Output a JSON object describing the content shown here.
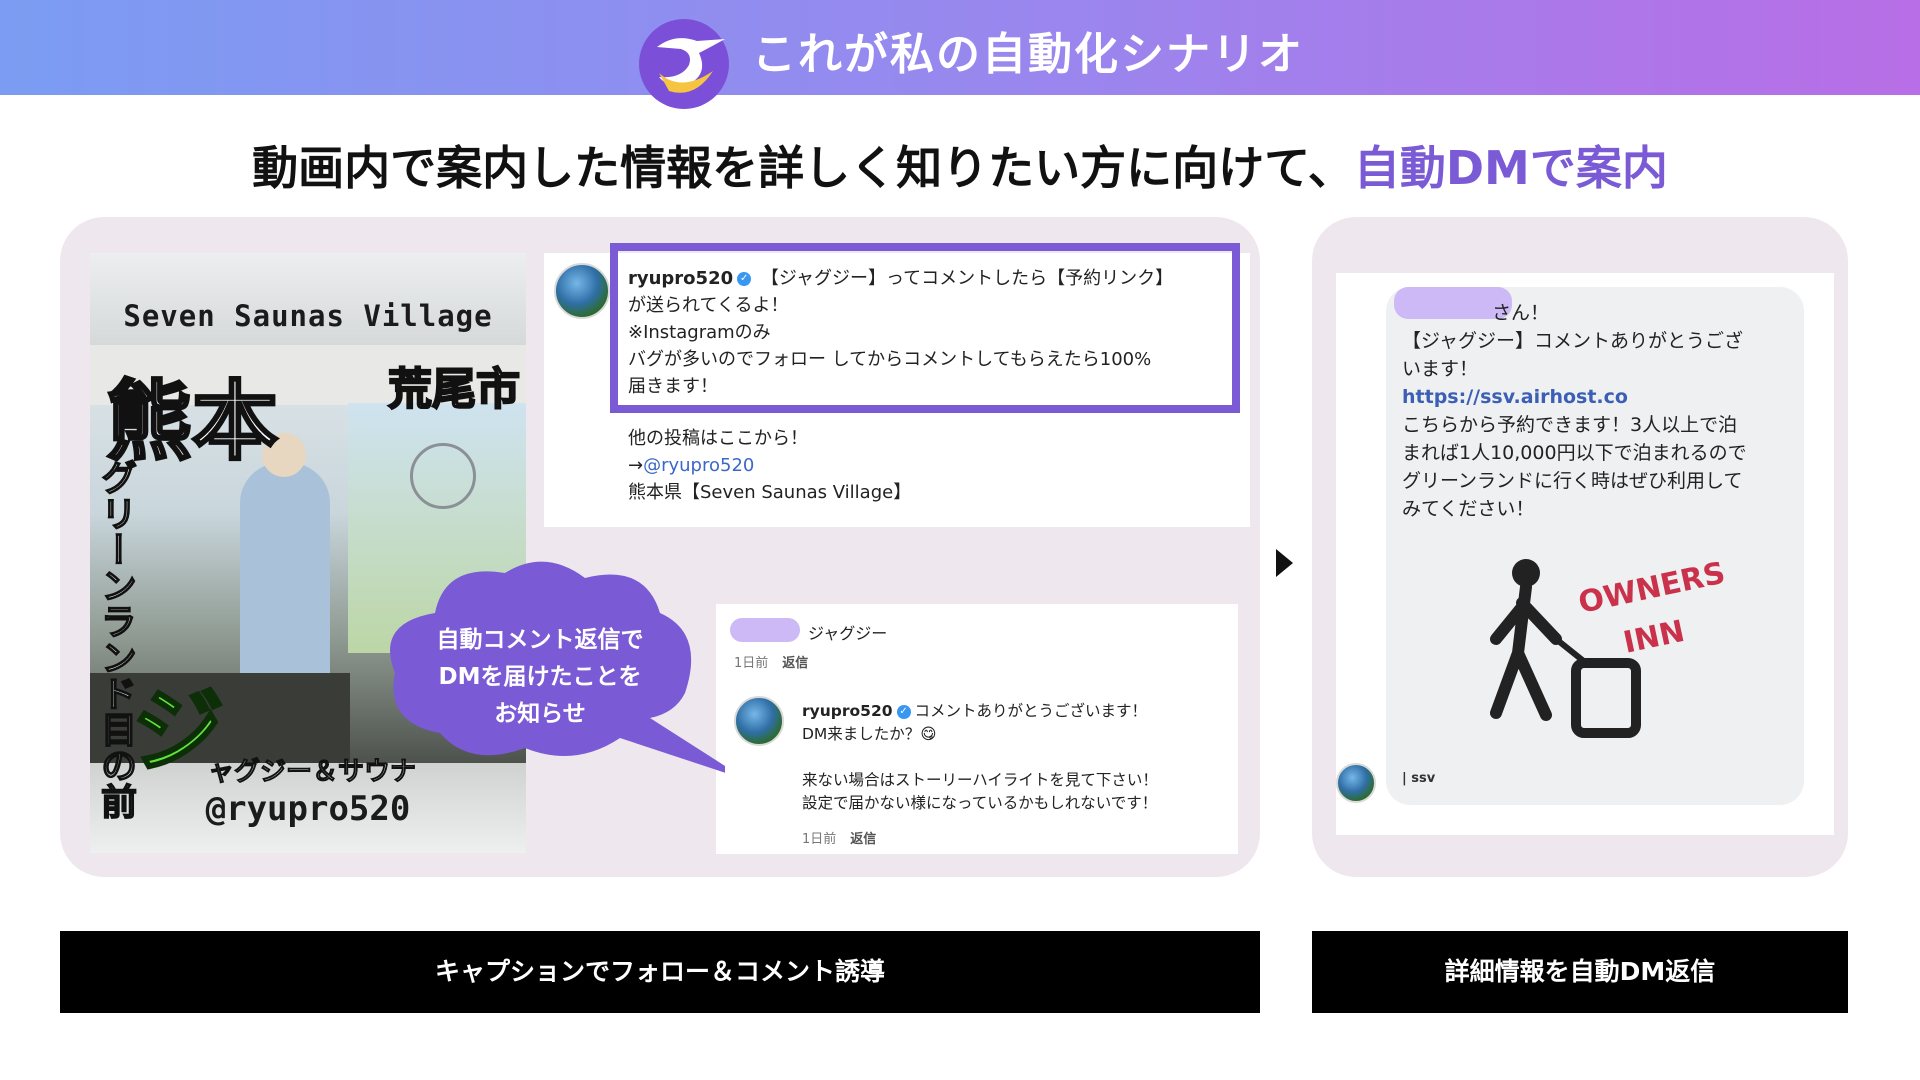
{
  "banner": {
    "title": "これが私の自動化シナリオ",
    "colors": {
      "start": "#7b9cf2",
      "end": "#b86ee6"
    }
  },
  "headline": {
    "text": "動画内で案内した情報を詳しく知りたい方に向けて、",
    "accent": "自動DMで案内",
    "accent_color": "#7b5ad6"
  },
  "thumbnail": {
    "venue": "Seven Saunas Village",
    "city_large": "熊本",
    "city_small": "荒尾市",
    "vertical": "グリーンランド目の前",
    "highlight": "ジ",
    "sub": "ャグジー＆サウナ",
    "handle": "@ryupro520"
  },
  "caption": {
    "username": "ryupro520",
    "line1": "【ジャグジー】ってコメントしたら【予約リンク】",
    "line2": "が送られてくるよ！",
    "line3": "※Instagramのみ",
    "line4": "バグが多いのでフォロー してからコメントしてもらえたら100%",
    "line5": "届きます！",
    "more1": "他の投稿はここから！",
    "more2_arrow": "→",
    "more2_link": "@ryupro520",
    "more3": "熊本県【Seven Saunas Village】",
    "highlight_color": "#7b5ad6"
  },
  "comment": {
    "text": "ジャグジー",
    "meta_time": "1日前",
    "meta_reply": "返信",
    "reply_user": "ryupro520",
    "reply_line1": "コメントありがとうございます！",
    "reply_line2": "DM来ましたか？😋",
    "reply_line3": "来ない場合はストーリーハイライトを見て下さい！",
    "reply_line4": "設定で届かない様になっているかもしれないです！",
    "reply_time": "1日前",
    "reply_reply": "返信"
  },
  "bubble": {
    "line1": "自動コメント返信で",
    "line2": "DMを届けたことを",
    "line3": "お知らせ",
    "color": "#7b5ad6"
  },
  "dm": {
    "greeting_suffix": "さん！",
    "line2": "【ジャグジー】コメントありがとうござ",
    "line3": "います！",
    "link": "https://ssv.airhost.co",
    "line5": "こちらから予約できます！3人以上で泊",
    "line6": "まれば1人10,000円以下で泊まれるので",
    "line7": "グリーンランドに行く時はぜひ利用して",
    "line8": "みてください！",
    "sketch_text": "OWNERS INN",
    "tag": "| ssv"
  },
  "bars": {
    "left": "キャプションでフォロー＆コメント誘導",
    "right": "詳細情報を自動DM返信"
  }
}
